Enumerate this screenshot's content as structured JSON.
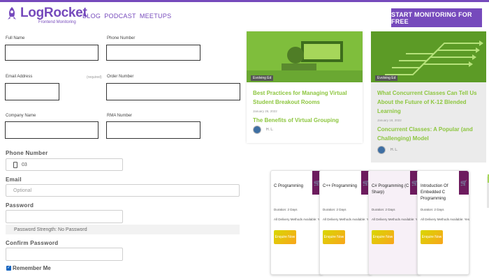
{
  "header": {
    "logo_word": "LogRocket",
    "logo_sub": "Frontend Monitoring",
    "nav": [
      "BLOG",
      "PODCAST",
      "MEETUPS"
    ],
    "cta": "START MONITORING FOR FREE",
    "accent": "#764abc"
  },
  "form": {
    "full_name": "Full Name",
    "phone_number_small": "Phone Number",
    "email": "Email Address",
    "required": "(required)",
    "order_number": "Order Number",
    "company": "Company Name",
    "rma": "RMA Number",
    "phone_label": "Phone Number",
    "phone_value": "03",
    "email_label": "Email",
    "email_placeholder": "Optional",
    "password_label": "Password",
    "strength": "Password Strength: No Password",
    "confirm_label": "Confirm Password",
    "remember": "Remember Me",
    "check": "✓"
  },
  "blog": [
    {
      "tag": "Evolving Ed",
      "title": "Best Practices for Managing Virtual Student Breakout Rooms",
      "date": "January 26, 2022",
      "sub": "The Benefits of Virtual Grouping",
      "author": "H. L."
    },
    {
      "tag": "Evolving Ed",
      "title": "What Concurrent Classes Can Tell Us About the Future of K-12 Blended Learning",
      "date": "January 18, 2022",
      "sub": "Concurrent Classes: A Popular (and Challenging) Model",
      "author": "H. L."
    }
  ],
  "courses": [
    {
      "title": "C Programming",
      "duration": "Duration: 2 Days",
      "mode": "All Delivery Methods Available: Yes",
      "enquire": "Enquire Now"
    },
    {
      "title": "C++ Programming",
      "duration": "Duration: 2 Days",
      "mode": "All Delivery Methods Available: Yes",
      "enquire": "Enquire Now"
    },
    {
      "title": "C# Programming (C Sharp)",
      "duration": "Duration: 2 Days",
      "mode": "All Delivery Methods Available: Yes",
      "enquire": "Enquire Now"
    },
    {
      "title": "Introduction Of Embedded C Programming",
      "duration": "Duration: 2 Days",
      "mode": "All Delivery Methods Available: Yes",
      "enquire": "Enquire Now"
    }
  ]
}
